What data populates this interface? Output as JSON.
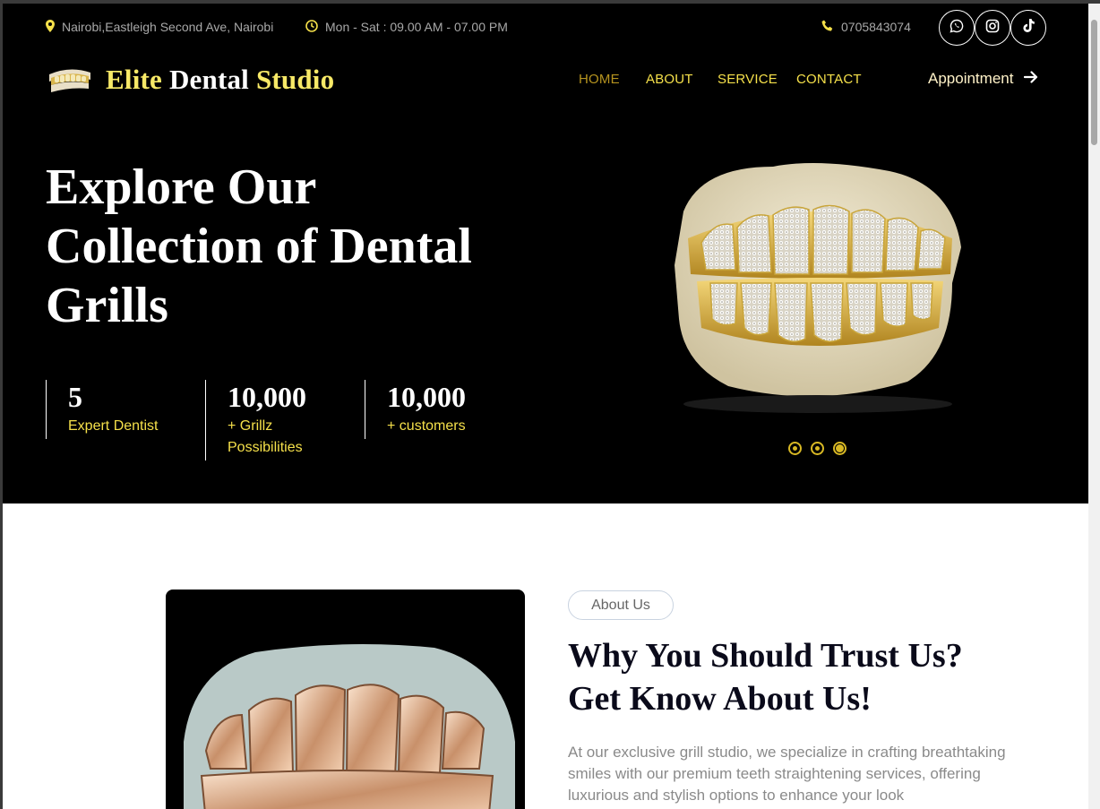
{
  "topbar": {
    "address": "Nairobi,Eastleigh Second Ave, Nairobi",
    "hours": "Mon - Sat : 09.00 AM - 07.00 PM",
    "phone": "0705843074",
    "socials": [
      {
        "icon": "whatsapp-icon"
      },
      {
        "icon": "instagram-icon"
      },
      {
        "icon": "tiktok-icon"
      }
    ]
  },
  "brand": {
    "part1": "Elite",
    "part2": "Dental",
    "part3": "Studio"
  },
  "nav": {
    "items": [
      {
        "label": "HOME",
        "active": true
      },
      {
        "label": "ABOUT",
        "active": false
      },
      {
        "label": "SERVICE",
        "active": false
      },
      {
        "label": "CONTACT",
        "active": false
      }
    ],
    "appointment": "Appointment"
  },
  "hero": {
    "title_line1": "Explore Our",
    "title_line2": "Collection of Dental",
    "title_line3": "Grills",
    "stats": [
      {
        "value": "5",
        "label": "Expert Dentist"
      },
      {
        "value": "10,000",
        "label_line1": "+ Grillz",
        "label_line2": "Possibilities"
      },
      {
        "value": "10,000",
        "label": "+ customers"
      }
    ],
    "slider_dots": 3,
    "active_dot": 3
  },
  "about": {
    "badge": "About Us",
    "title_line1": "Why You Should Trust Us?",
    "title_line2": "Get Know About Us!",
    "text": "At our exclusive grill studio, we specialize in crafting breathtaking smiles with our premium teeth straightening services, offering luxurious and stylish options to enhance your look"
  },
  "colors": {
    "accent_yellow": "#f5e04a",
    "active_nav": "#b5931f",
    "hero_bg": "#000000"
  }
}
